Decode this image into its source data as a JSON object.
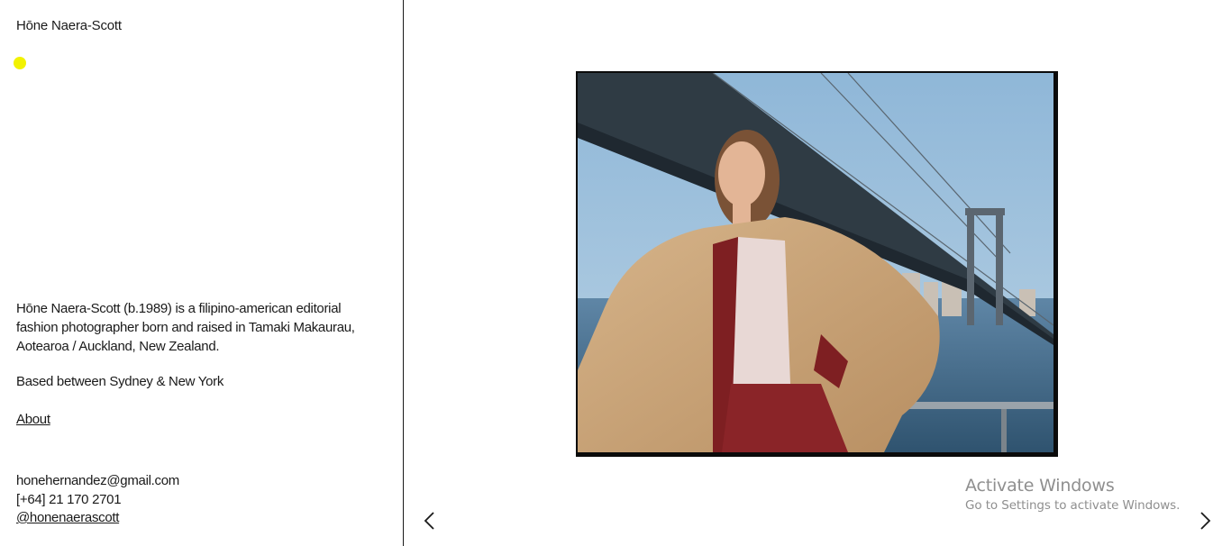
{
  "site": {
    "title": "Hōne Naera-Scott"
  },
  "bio": {
    "text": "Hōne Naera-Scott (b.1989) is a filipino-american editorial fashion photographer born and raised in Tamaki Makaurau, Aotearoa / Auckland, New Zealand.",
    "location": "Based between Sydney & New York"
  },
  "nav": {
    "about_label": "About"
  },
  "contact": {
    "email": "honehernandez@gmail.com",
    "phone": "[+64] 21 170 2701",
    "instagram": "@honenaerascott"
  },
  "gallery": {
    "prev_icon": "chevron-left-icon",
    "next_icon": "chevron-right-icon"
  },
  "watermark": {
    "title": "Activate Windows",
    "subtitle": "Go to Settings to activate Windows."
  },
  "colors": {
    "accent_dot": "#f2f200",
    "text": "#1a1a1a",
    "background": "#ffffff"
  }
}
